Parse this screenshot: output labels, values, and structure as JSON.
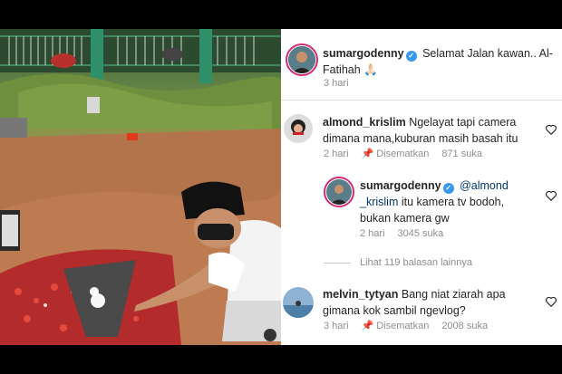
{
  "post": {
    "caption_user": "sumargodenny",
    "caption_text": "Selamat Jalan kawan.. Al-Fatihah",
    "caption_emoji": "🙏🏻",
    "caption_time": "3 hari"
  },
  "comments": [
    {
      "username": "almond_krislim",
      "text": "Ngelayat tapi camera dimana mana,kuburan masih basah itu",
      "time": "2 hari",
      "pinned_label": "Disematkan",
      "likes": "871 suka"
    },
    {
      "username": "sumargodenny",
      "mention": "@almond _krislim",
      "text": "itu kamera tv bodoh, bukan kamera gw",
      "time": "2 hari",
      "likes": "3045 suka"
    },
    {
      "username": "melvin_tytyan",
      "text": "Bang niat ziarah apa gimana kok sambil ngevlog?",
      "time": "3 hari",
      "pinned_label": "Disematkan",
      "likes": "2008 suka"
    }
  ],
  "view_replies": "Lihat 119 balasan lainnya",
  "icons": {
    "verified": "verified-badge-icon",
    "pin": "pin-icon",
    "heart": "heart-outline-icon"
  },
  "colors": {
    "verified": "#3897f0",
    "mention": "#00376b",
    "meta": "#8e8e8e",
    "story_ring": "#d62976"
  }
}
